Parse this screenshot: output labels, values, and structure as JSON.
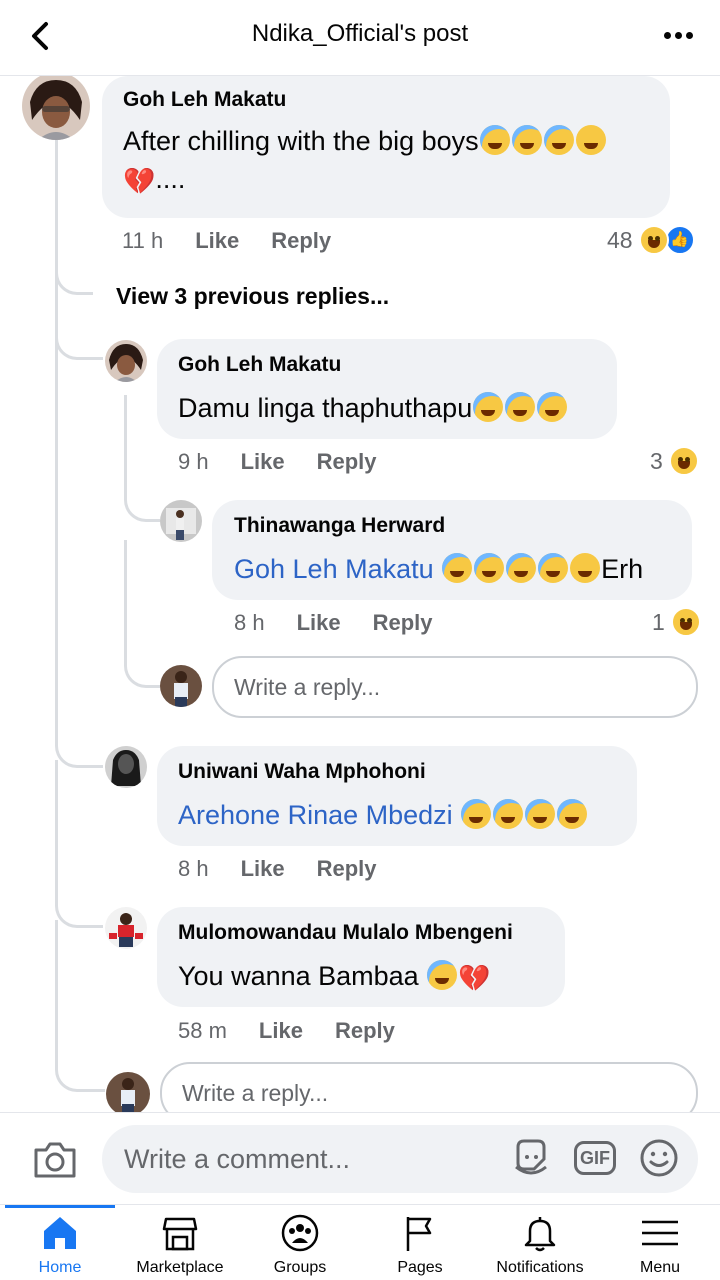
{
  "header": {
    "title": "Ndika_Official's post"
  },
  "thread": {
    "top_comment": {
      "author": "Goh Leh Makatu",
      "text": "After chilling with the big boys",
      "suffix": "....",
      "time": "11 h",
      "like_label": "Like",
      "reply_label": "Reply",
      "reaction_count": "48"
    },
    "view_previous": "View 3 previous replies...",
    "reply1": {
      "author": "Goh Leh Makatu",
      "text": "Damu linga thaphuthapu",
      "time": "9 h",
      "like_label": "Like",
      "reply_label": "Reply",
      "reaction_count": "3"
    },
    "reply1_sub": {
      "author": "Thinawanga Herward",
      "mention": "Goh Leh Makatu",
      "text": "Erh",
      "time": "8 h",
      "like_label": "Like",
      "reply_label": "Reply",
      "reaction_count": "1"
    },
    "reply1_input_placeholder": "Write a reply...",
    "reply2": {
      "author": "Uniwani Waha Mphohoni",
      "mention": "Arehone Rinae Mbedzi",
      "time": "8 h",
      "like_label": "Like",
      "reply_label": "Reply"
    },
    "reply3": {
      "author": "Mulomowandau Mulalo Mbengeni",
      "text": "You wanna Bambaa",
      "time": "58 m",
      "like_label": "Like",
      "reply_label": "Reply"
    },
    "thread_input_placeholder": "Write a reply..."
  },
  "composer": {
    "placeholder": "Write a comment...",
    "gif_label": "GIF"
  },
  "tabs": [
    {
      "label": "Home",
      "icon": "home-icon",
      "active": true
    },
    {
      "label": "Marketplace",
      "icon": "marketplace-icon"
    },
    {
      "label": "Groups",
      "icon": "groups-icon"
    },
    {
      "label": "Pages",
      "icon": "flag-icon"
    },
    {
      "label": "Notifications",
      "icon": "bell-icon"
    },
    {
      "label": "Menu",
      "icon": "hamburger-icon"
    }
  ],
  "colors": {
    "accent": "#1877f2",
    "mention": "#2d64c6",
    "bubble": "#f0f2f5",
    "muted": "#65676b"
  }
}
